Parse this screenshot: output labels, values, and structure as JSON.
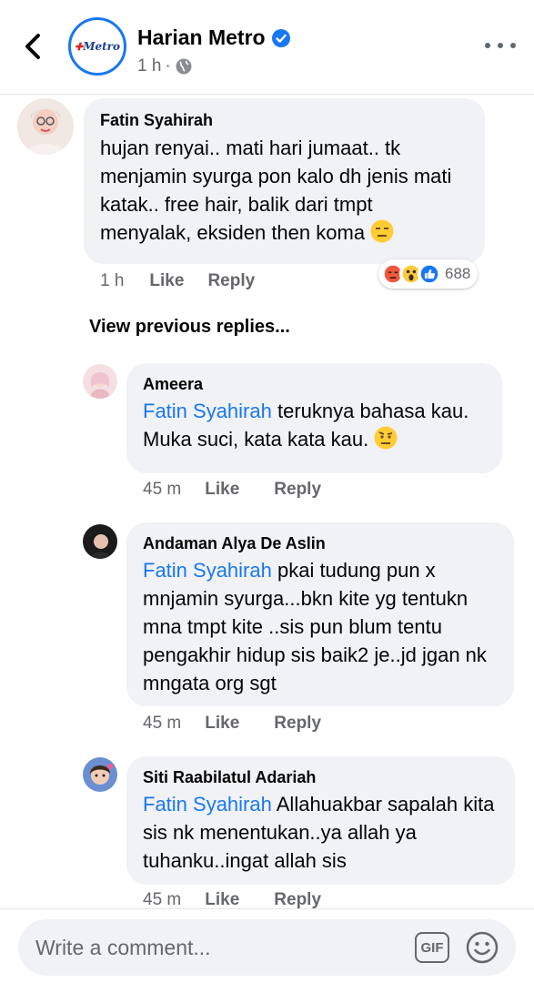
{
  "header": {
    "page_name": "Harian Metro",
    "time": "1 h",
    "separator": "·",
    "logo_text": "Metro"
  },
  "main_comment": {
    "author": "Fatin Syahirah",
    "text": "hujan renyai.. mati hari jumaat.. tk menjamin syurga pon kalo dh jenis mati katak.. free hair, balik dari tmpt menyalak, eksiden then koma",
    "emoji": "expressionless-face-icon",
    "time": "1 h",
    "like": "Like",
    "reply": "Reply",
    "reactions": {
      "icons": [
        "angry-icon",
        "wow-icon",
        "like-icon"
      ],
      "count": "688"
    }
  },
  "view_previous": "View previous replies...",
  "replies": [
    {
      "author": "Ameera",
      "mention": "Fatin Syahirah",
      "text": " teruknya bahasa kau. Muka suci, kata kata kau. ",
      "emoji": "raised-eyebrow-face-icon",
      "time": "45 m",
      "like": "Like",
      "reply": "Reply"
    },
    {
      "author": "Andaman Alya De Aslin",
      "mention": "Fatin Syahirah",
      "text": " pkai tudung pun x mnjamin syurga...bkn kite yg tentukn mna tmpt kite ..sis pun blum tentu pengakhir hidup sis baik2 je..jd jgan nk mngata org sgt",
      "time": "45 m",
      "like": "Like",
      "reply": "Reply"
    },
    {
      "author": "Siti Raabilatul Adariah",
      "mention": "Fatin Syahirah",
      "text": " Allahuakbar sapalah kita sis nk menentukan..ya allah ya tuhanku..ingat allah sis",
      "time": "45 m",
      "like": "Like",
      "reply": "Reply"
    }
  ],
  "composer": {
    "placeholder": "Write a comment...",
    "gif_label": "GIF"
  },
  "colors": {
    "accent": "#1877f2",
    "bubble": "#f0f2f5",
    "secondary_text": "#65676b"
  }
}
